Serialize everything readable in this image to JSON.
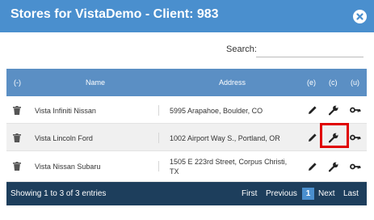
{
  "dialog": {
    "title": "Stores for VistaDemo - Client: 983"
  },
  "search": {
    "label": "Search:",
    "value": ""
  },
  "table": {
    "columns": [
      "(-)",
      "Name",
      "Address",
      "(e)",
      "(c)",
      "(u)"
    ],
    "rows": [
      {
        "name": "Vista Infiniti Nissan",
        "address": "5995 Arapahoe, Boulder, CO"
      },
      {
        "name": "Vista Lincoln Ford",
        "address": "1002 Airport Way S., Portland, OR"
      },
      {
        "name": "Vista Nissan Subaru",
        "address": "1505 E 223rd Street, Corpus Christi, TX"
      }
    ],
    "row_icons": {
      "delete": "trash-icon",
      "edit": "pencil-icon",
      "configure": "wrench-icon",
      "users": "key-icon"
    }
  },
  "footer": {
    "info": "Showing 1 to 3 of 3 entries",
    "first": "First",
    "previous": "Previous",
    "current_page": "1",
    "next": "Next",
    "last": "Last"
  },
  "colors": {
    "header": "#4a8fce",
    "table_header": "#5b8fc4",
    "footer": "#1d3e5c",
    "highlight": "#e00000"
  }
}
